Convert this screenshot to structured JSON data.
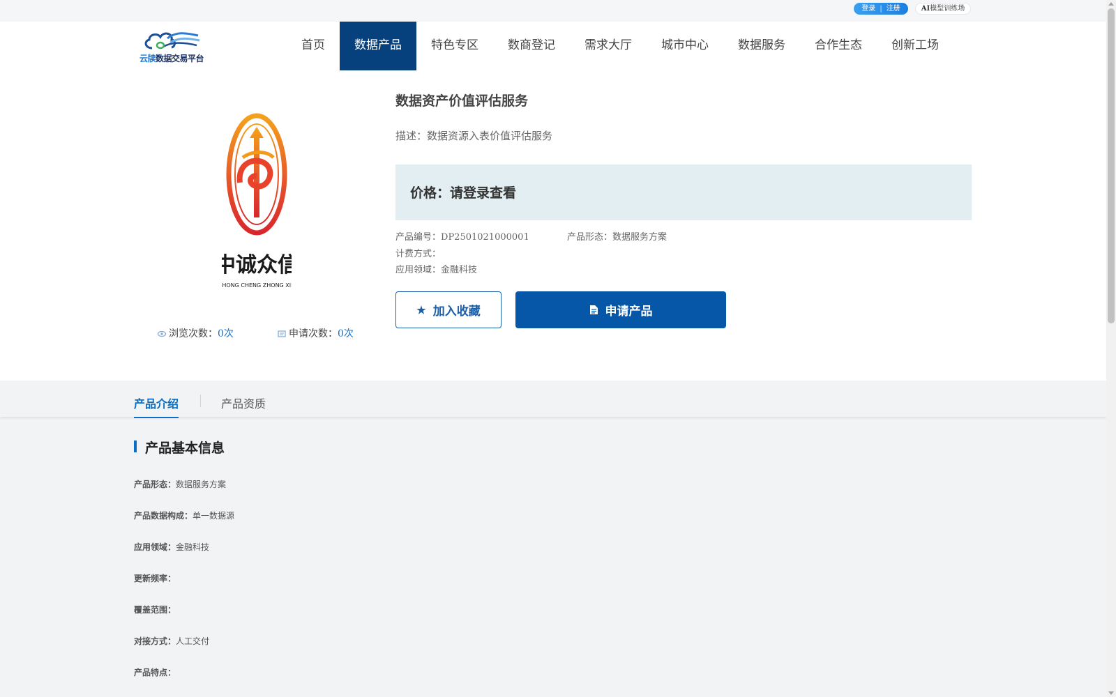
{
  "topbar": {
    "login": "登录",
    "separator": "|",
    "register": "注册",
    "ai_prefix": "AI",
    "ai_label": "模型训练场"
  },
  "header": {
    "logo_text_blue": "云牍",
    "logo_text_dark": "数据交易平台",
    "nav": [
      "首页",
      "数据产品",
      "特色专区",
      "数商登记",
      "需求大厅",
      "城市中心",
      "数据服务",
      "合作生态",
      "创新工场"
    ],
    "active_nav": "数据产品"
  },
  "product": {
    "title": "数据资产价值评估服务",
    "description": "描述：数据资源入表价值评估服务",
    "price": "价格：请登录查看",
    "code_label": "产品编号：",
    "code": "DP2501021000001",
    "form_label": "产品形态：",
    "form": "数据服务方案",
    "billing_label": "计费方式：",
    "billing": "",
    "domain_label": "应用领域：",
    "domain": "金融科技",
    "logo_cn": "中诚众信",
    "logo_en": "ZHONG CHENG ZHONG XIN",
    "views_label": "浏览次数：",
    "views": "0次",
    "applies_label": "申请次数：",
    "applies": "0次",
    "fav_button": "加入收藏",
    "apply_button": "申请产品",
    "colors": {
      "primary": "#0757a8",
      "nav_active": "#06407d",
      "price_bg": "#e2eef2",
      "accent": "#0a6fc4"
    }
  },
  "tabs": [
    "产品介绍",
    "产品资质"
  ],
  "active_tab": "产品介绍",
  "info": {
    "heading": "产品基本信息",
    "rows": [
      {
        "key": "产品形态：",
        "value": "数据服务方案"
      },
      {
        "key": "产品数据构成：",
        "value": "单一数据源"
      },
      {
        "key": "应用领域：",
        "value": "金融科技"
      },
      {
        "key": "更新频率：",
        "value": ""
      },
      {
        "key": "覆盖范围：",
        "value": ""
      },
      {
        "key": "对接方式：",
        "value": "人工交付"
      },
      {
        "key": "产品特点：",
        "value": ""
      }
    ]
  }
}
